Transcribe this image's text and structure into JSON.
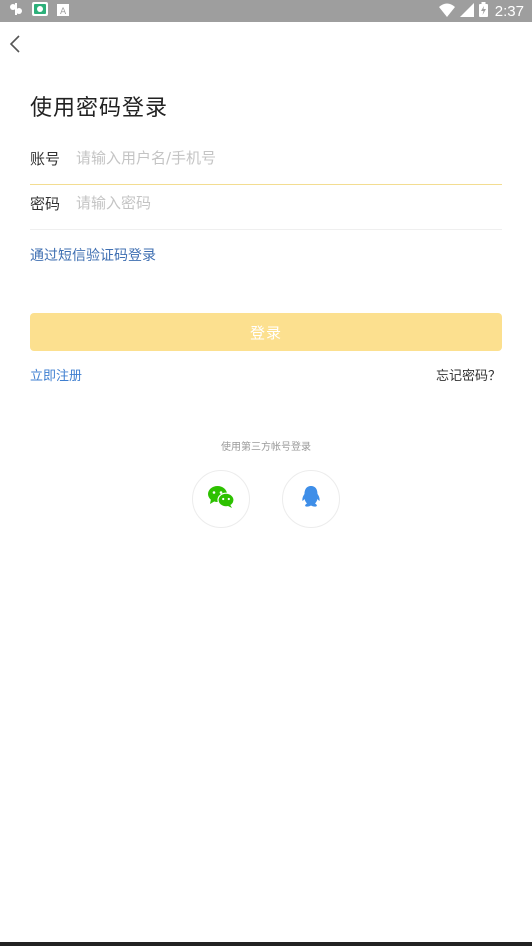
{
  "status_bar": {
    "time": "2:37",
    "icons": [
      "notification-app-icon",
      "store-app-icon",
      "a-app-icon",
      "wifi-icon",
      "signal-icon",
      "battery-icon"
    ]
  },
  "header": {
    "back_icon": "back-chevron-icon"
  },
  "page": {
    "title": "使用密码登录"
  },
  "form": {
    "account_label": "账号",
    "account_placeholder": "请输入用户名/手机号",
    "account_value": "",
    "password_label": "密码",
    "password_placeholder": "请输入密码",
    "password_value": ""
  },
  "links": {
    "sms_login": "通过短信验证码登录",
    "register": "立即注册",
    "forgot_password": "忘记密码？"
  },
  "login_button": {
    "label": "登录",
    "color": "#fce08f"
  },
  "third_party": {
    "label": "使用第三方帐号登录",
    "providers": [
      {
        "icon": "wechat-icon",
        "color": "#2dc100"
      },
      {
        "icon": "qq-icon",
        "color": "#3e8ee8"
      }
    ]
  },
  "colors": {
    "accent_link": "#3f7fd0",
    "active_underline": "#f3dd91",
    "status_bar": "#9e9e9e"
  }
}
